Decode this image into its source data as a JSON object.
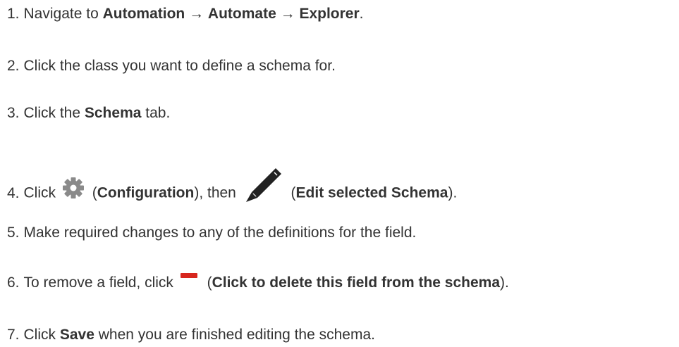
{
  "steps": [
    {
      "num": "1.",
      "text_a": "Navigate to ",
      "bold_a": "Automation",
      "arrow_a": " → ",
      "bold_b": "Automate",
      "arrow_b": " → ",
      "bold_c": "Explorer",
      "end": "."
    },
    {
      "num": "2.",
      "text": "Click the class you want to define a schema for."
    },
    {
      "num": "3.",
      "text_a": "Click the ",
      "bold": "Schema",
      "text_b": " tab."
    },
    {
      "num": "4.",
      "text_a": "Click ",
      "icon_a": "gear-icon",
      "paren_open_a": " (",
      "bold_a": "Configuration",
      "text_b": "), then ",
      "icon_b": "pencil-icon",
      "paren_open_b": " (",
      "bold_b": "Edit selected Schema",
      "end": ")."
    },
    {
      "num": "5.",
      "text": "Make required changes to any of the definitions for the field."
    },
    {
      "num": "6.",
      "text_a": "To remove a field, click ",
      "icon": "minus-icon",
      "paren_open": " (",
      "bold": "Click to delete this field from the schema",
      "end": ")."
    },
    {
      "num": "7.",
      "text_a": "Click ",
      "bold": "Save",
      "text_b": " when you are finished editing the schema."
    }
  ],
  "colors": {
    "text": "#333333",
    "gear": "#8a8a8a",
    "pencil": "#222222",
    "minus": "#d7261e"
  }
}
